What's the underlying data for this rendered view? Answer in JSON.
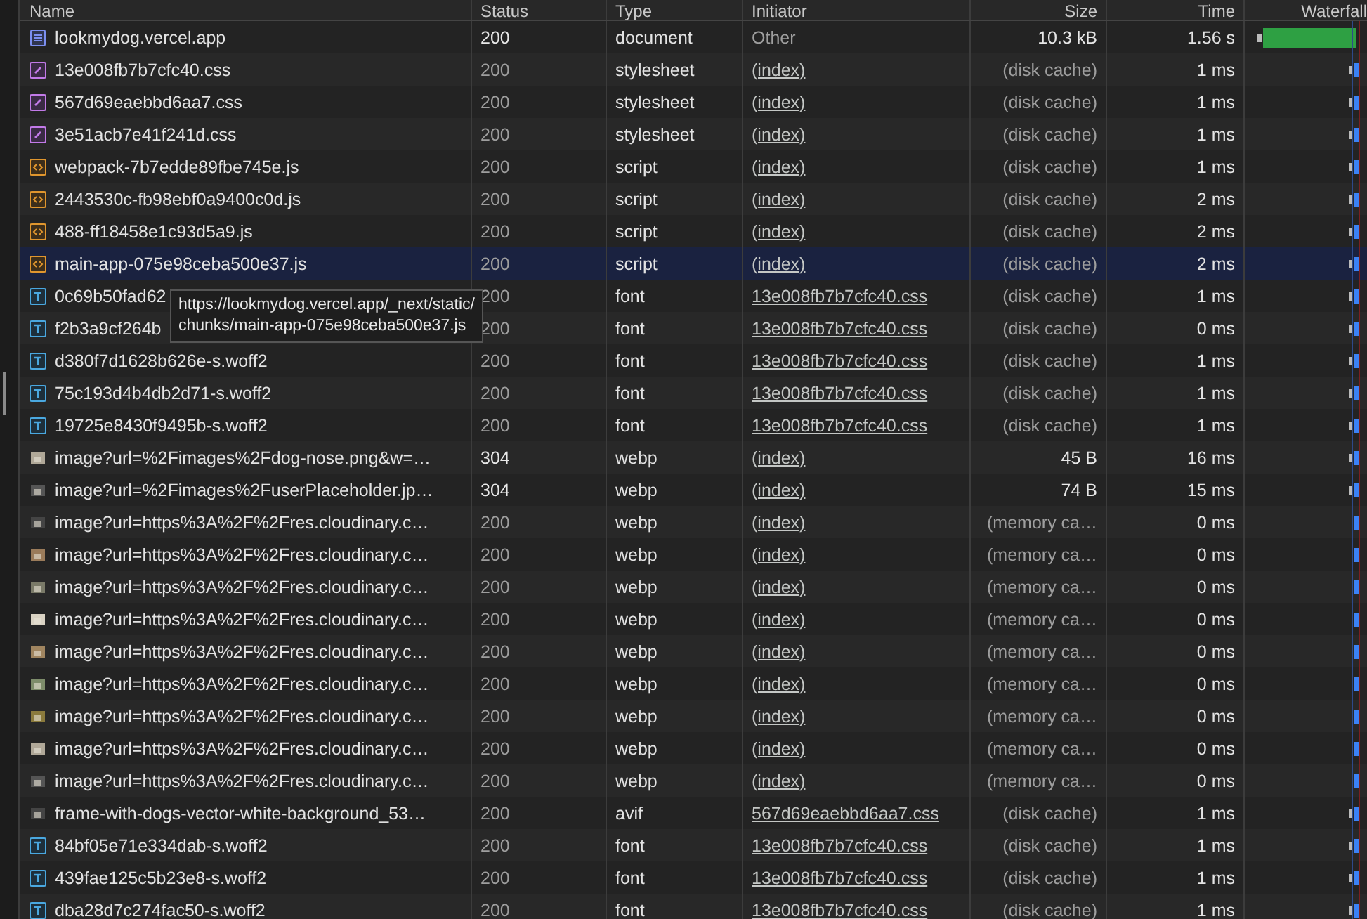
{
  "table": {
    "columns": [
      "Name",
      "Status",
      "Type",
      "Initiator",
      "Size",
      "Time",
      "Waterfall"
    ],
    "rows": [
      {
        "name": "lookmydog.vercel.app",
        "status": "200",
        "type": "document",
        "initiator": "Other",
        "initiator_link": false,
        "size": "10.3 kB",
        "time": "1.56 s",
        "kind": "document",
        "from_cache": false,
        "selected": false
      },
      {
        "name": "13e008fb7b7cfc40.css",
        "status": "200",
        "type": "stylesheet",
        "initiator": "(index)",
        "initiator_link": true,
        "size": "(disk cache)",
        "time": "1 ms",
        "kind": "stylesheet",
        "from_cache": true,
        "selected": false
      },
      {
        "name": "567d69eaebbd6aa7.css",
        "status": "200",
        "type": "stylesheet",
        "initiator": "(index)",
        "initiator_link": true,
        "size": "(disk cache)",
        "time": "1 ms",
        "kind": "stylesheet",
        "from_cache": true,
        "selected": false
      },
      {
        "name": "3e51acb7e41f241d.css",
        "status": "200",
        "type": "stylesheet",
        "initiator": "(index)",
        "initiator_link": true,
        "size": "(disk cache)",
        "time": "1 ms",
        "kind": "stylesheet",
        "from_cache": true,
        "selected": false
      },
      {
        "name": "webpack-7b7edde89fbe745e.js",
        "status": "200",
        "type": "script",
        "initiator": "(index)",
        "initiator_link": true,
        "size": "(disk cache)",
        "time": "1 ms",
        "kind": "script",
        "from_cache": true,
        "selected": false
      },
      {
        "name": "2443530c-fb98ebf0a9400c0d.js",
        "status": "200",
        "type": "script",
        "initiator": "(index)",
        "initiator_link": true,
        "size": "(disk cache)",
        "time": "2 ms",
        "kind": "script",
        "from_cache": true,
        "selected": false
      },
      {
        "name": "488-ff18458e1c93d5a9.js",
        "status": "200",
        "type": "script",
        "initiator": "(index)",
        "initiator_link": true,
        "size": "(disk cache)",
        "time": "2 ms",
        "kind": "script",
        "from_cache": true,
        "selected": false
      },
      {
        "name": "main-app-075e98ceba500e37.js",
        "status": "200",
        "type": "script",
        "initiator": "(index)",
        "initiator_link": true,
        "size": "(disk cache)",
        "time": "2 ms",
        "kind": "script",
        "from_cache": true,
        "selected": true
      },
      {
        "name": "0c69b50fad62",
        "status": "200",
        "type": "font",
        "initiator": "13e008fb7b7cfc40.css",
        "initiator_link": true,
        "size": "(disk cache)",
        "time": "1 ms",
        "kind": "font",
        "from_cache": true,
        "selected": false
      },
      {
        "name": "f2b3a9cf264b",
        "status": "200",
        "type": "font",
        "initiator": "13e008fb7b7cfc40.css",
        "initiator_link": true,
        "size": "(disk cache)",
        "time": "0 ms",
        "kind": "font",
        "from_cache": true,
        "selected": false
      },
      {
        "name": "d380f7d1628b626e-s.woff2",
        "status": "200",
        "type": "font",
        "initiator": "13e008fb7b7cfc40.css",
        "initiator_link": true,
        "size": "(disk cache)",
        "time": "1 ms",
        "kind": "font",
        "from_cache": true,
        "selected": false
      },
      {
        "name": "75c193d4b4db2d71-s.woff2",
        "status": "200",
        "type": "font",
        "initiator": "13e008fb7b7cfc40.css",
        "initiator_link": true,
        "size": "(disk cache)",
        "time": "1 ms",
        "kind": "font",
        "from_cache": true,
        "selected": false
      },
      {
        "name": "19725e8430f9495b-s.woff2",
        "status": "200",
        "type": "font",
        "initiator": "13e008fb7b7cfc40.css",
        "initiator_link": true,
        "size": "(disk cache)",
        "time": "1 ms",
        "kind": "font",
        "from_cache": true,
        "selected": false
      },
      {
        "name": "image?url=%2Fimages%2Fdog-nose.png&w=…",
        "status": "304",
        "type": "webp",
        "initiator": "(index)",
        "initiator_link": true,
        "size": "45 B",
        "time": "16 ms",
        "kind": "image",
        "from_cache": false,
        "selected": false
      },
      {
        "name": "image?url=%2Fimages%2FuserPlaceholder.jp…",
        "status": "304",
        "type": "webp",
        "initiator": "(index)",
        "initiator_link": true,
        "size": "74 B",
        "time": "15 ms",
        "kind": "image",
        "from_cache": false,
        "selected": false
      },
      {
        "name": "image?url=https%3A%2F%2Fres.cloudinary.c…",
        "status": "200",
        "type": "webp",
        "initiator": "(index)",
        "initiator_link": true,
        "size": "(memory ca…",
        "time": "0 ms",
        "kind": "image",
        "from_cache": true,
        "selected": false
      },
      {
        "name": "image?url=https%3A%2F%2Fres.cloudinary.c…",
        "status": "200",
        "type": "webp",
        "initiator": "(index)",
        "initiator_link": true,
        "size": "(memory ca…",
        "time": "0 ms",
        "kind": "image",
        "from_cache": true,
        "selected": false
      },
      {
        "name": "image?url=https%3A%2F%2Fres.cloudinary.c…",
        "status": "200",
        "type": "webp",
        "initiator": "(index)",
        "initiator_link": true,
        "size": "(memory ca…",
        "time": "0 ms",
        "kind": "image",
        "from_cache": true,
        "selected": false
      },
      {
        "name": "image?url=https%3A%2F%2Fres.cloudinary.c…",
        "status": "200",
        "type": "webp",
        "initiator": "(index)",
        "initiator_link": true,
        "size": "(memory ca…",
        "time": "0 ms",
        "kind": "image",
        "from_cache": true,
        "selected": false
      },
      {
        "name": "image?url=https%3A%2F%2Fres.cloudinary.c…",
        "status": "200",
        "type": "webp",
        "initiator": "(index)",
        "initiator_link": true,
        "size": "(memory ca…",
        "time": "0 ms",
        "kind": "image",
        "from_cache": true,
        "selected": false
      },
      {
        "name": "image?url=https%3A%2F%2Fres.cloudinary.c…",
        "status": "200",
        "type": "webp",
        "initiator": "(index)",
        "initiator_link": true,
        "size": "(memory ca…",
        "time": "0 ms",
        "kind": "image",
        "from_cache": true,
        "selected": false
      },
      {
        "name": "image?url=https%3A%2F%2Fres.cloudinary.c…",
        "status": "200",
        "type": "webp",
        "initiator": "(index)",
        "initiator_link": true,
        "size": "(memory ca…",
        "time": "0 ms",
        "kind": "image",
        "from_cache": true,
        "selected": false
      },
      {
        "name": "image?url=https%3A%2F%2Fres.cloudinary.c…",
        "status": "200",
        "type": "webp",
        "initiator": "(index)",
        "initiator_link": true,
        "size": "(memory ca…",
        "time": "0 ms",
        "kind": "image",
        "from_cache": true,
        "selected": false
      },
      {
        "name": "image?url=https%3A%2F%2Fres.cloudinary.c…",
        "status": "200",
        "type": "webp",
        "initiator": "(index)",
        "initiator_link": true,
        "size": "(memory ca…",
        "time": "0 ms",
        "kind": "image",
        "from_cache": true,
        "selected": false
      },
      {
        "name": "frame-with-dogs-vector-white-background_53…",
        "status": "200",
        "type": "avif",
        "initiator": "567d69eaebbd6aa7.css",
        "initiator_link": true,
        "size": "(disk cache)",
        "time": "1 ms",
        "kind": "image",
        "from_cache": true,
        "selected": false
      },
      {
        "name": "84bf05e71e334dab-s.woff2",
        "status": "200",
        "type": "font",
        "initiator": "13e008fb7b7cfc40.css",
        "initiator_link": true,
        "size": "(disk cache)",
        "time": "1 ms",
        "kind": "font",
        "from_cache": true,
        "selected": false
      },
      {
        "name": "439fae125c5b23e8-s.woff2",
        "status": "200",
        "type": "font",
        "initiator": "13e008fb7b7cfc40.css",
        "initiator_link": true,
        "size": "(disk cache)",
        "time": "1 ms",
        "kind": "font",
        "from_cache": true,
        "selected": false
      },
      {
        "name": "dba28d7c274fac50-s.woff2",
        "status": "200",
        "type": "font",
        "initiator": "13e008fb7b7cfc40.css",
        "initiator_link": true,
        "size": "(disk cache)",
        "time": "1 ms",
        "kind": "font",
        "from_cache": true,
        "selected": false
      }
    ]
  },
  "tooltip": {
    "lines": [
      "https://lookmydog.vercel.app/_next/static/",
      "chunks/main-app-075e98ceba500e37.js"
    ]
  }
}
